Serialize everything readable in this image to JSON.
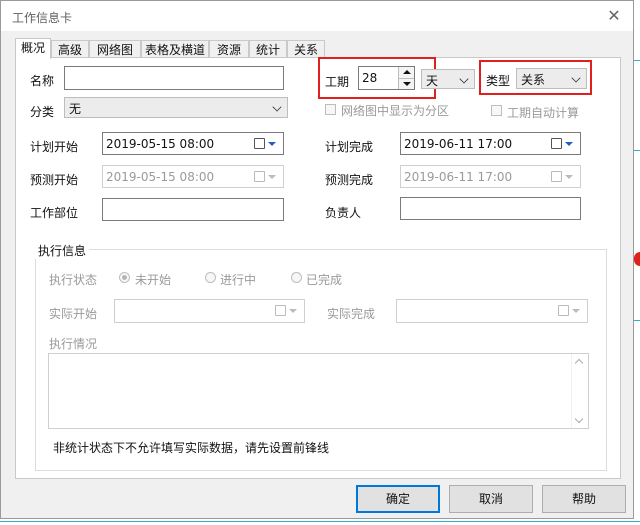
{
  "window": {
    "title": "工作信息卡",
    "close_glyph": "✕"
  },
  "tabs": [
    {
      "label": "概况",
      "active": true
    },
    {
      "label": "高级"
    },
    {
      "label": "网络图"
    },
    {
      "label": "表格及横道"
    },
    {
      "label": "资源"
    },
    {
      "label": "统计"
    },
    {
      "label": "关系"
    }
  ],
  "form": {
    "name_label": "名称",
    "name_value": "",
    "category_label": "分类",
    "category_value": "无",
    "duration_label": "工期",
    "duration_value": "28",
    "duration_unit": "天",
    "type_label": "类型",
    "type_value": "关系",
    "show_as_zone_label": "网络图中显示为分区",
    "auto_calc_label": "工期自动计算",
    "plan_start_label": "计划开始",
    "plan_start_value": "2019-05-15 08:00",
    "plan_finish_label": "计划完成",
    "plan_finish_value": "2019-06-11 17:00",
    "forecast_start_label": "预测开始",
    "forecast_start_value": "2019-05-15 08:00",
    "forecast_finish_label": "预测完成",
    "forecast_finish_value": "2019-06-11 17:00",
    "dept_label": "工作部位",
    "dept_value": "",
    "owner_label": "负责人",
    "owner_value": ""
  },
  "execution": {
    "group_title": "执行信息",
    "status_label": "执行状态",
    "status_options": [
      "未开始",
      "进行中",
      "已完成"
    ],
    "status_selected": "未开始",
    "actual_start_label": "实际开始",
    "actual_finish_label": "实际完成",
    "notes_label": "执行情况",
    "notice": "非统计状态下不允许填写实际数据，请先设置前锋线"
  },
  "buttons": {
    "ok": "确定",
    "cancel": "取消",
    "help": "帮助"
  },
  "colors": {
    "highlight": "#e0201c",
    "accent": "#0078d7",
    "background_grid": "#2bb3c7"
  }
}
